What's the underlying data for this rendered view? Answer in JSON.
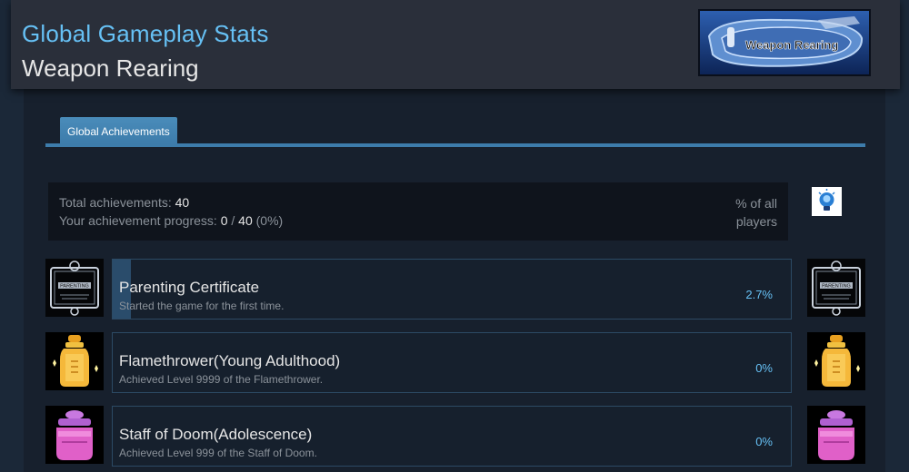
{
  "header": {
    "title": "Global Gameplay Stats",
    "game_name": "Weapon Rearing",
    "logo_text": "Weapon Rearing"
  },
  "tabs": [
    {
      "label": "Global Achievements",
      "active": true
    }
  ],
  "summary": {
    "total_label": "Total achievements:",
    "total_value": "40",
    "progress_label": "Your achievement progress:",
    "progress_unlocked": "0",
    "progress_sep": "/",
    "progress_total": "40",
    "progress_pct": "(0%)",
    "pct_header_line1": "% of all",
    "pct_header_line2": "players",
    "info_icon": "lightbulb-icon"
  },
  "achievements": [
    {
      "name": "Parenting Certificate",
      "description": "Started the game for the first time.",
      "percent": "2.7%",
      "fraction": 0.027,
      "icon": "certificate-icon",
      "icon_label": "PARENTING"
    },
    {
      "name": "Flamethrower(Young Adulthood)",
      "description": "Achieved Level 9999 of the Flamethrower.",
      "percent": "0%",
      "fraction": 0,
      "icon": "gold-bottle-icon"
    },
    {
      "name": "Staff of Doom(Adolescence)",
      "description": "Achieved Level 999 of the Staff of Doom.",
      "percent": "0%",
      "fraction": 0,
      "icon": "pink-bottle-icon"
    }
  ],
  "colors": {
    "accent": "#66c0f4",
    "tab": "#3d7cab",
    "background": "#1b2838",
    "bar": "#2a4c6b"
  }
}
